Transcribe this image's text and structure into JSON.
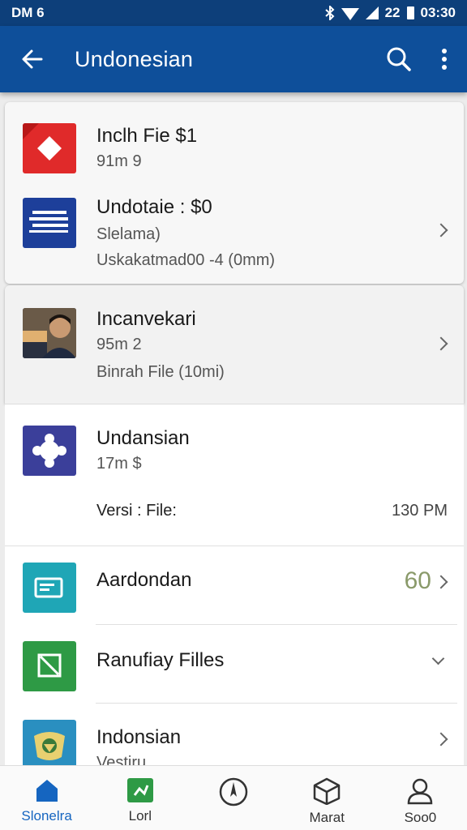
{
  "status_bar": {
    "left_text": "DM 6",
    "right_number": "22",
    "time": "03:30"
  },
  "app_bar": {
    "title": "Undonesian"
  },
  "items": [
    {
      "title": "Inclh Fie $1",
      "subtitle": "91m 9",
      "icon": "red-diamond-icon",
      "accent": "#e02a2a"
    },
    {
      "title": "Undotaie : $0",
      "subtitle": "Slelama)",
      "detail": "Uskakatmad00 -4 (0mm)",
      "icon": "flag-icon",
      "accent": "#1d3f9a"
    },
    {
      "title": "Incanvekari",
      "subtitle": "95m 2",
      "detail": "Binrah File (10mi)",
      "icon": "person-photo-icon"
    },
    {
      "title": "Undansian",
      "subtitle": "17m $",
      "detail_label": "Versi : File:",
      "detail_value": "130 PM",
      "icon": "puzzle-icon",
      "accent": "#3b3f9a"
    },
    {
      "title": "Aardondan",
      "value": "60",
      "value_color": "#8a9a6a",
      "icon": "card-icon",
      "accent": "#1fa6b6"
    },
    {
      "title": "Ranufiay Filles",
      "icon": "square-slash-icon",
      "accent": "#2e9a45"
    },
    {
      "title": "Indonsian",
      "subtitle": "Vestiru",
      "icon": "emblem-icon",
      "accent": "#2a8fc0"
    }
  ],
  "bottom_nav": [
    {
      "label": "Slonelra",
      "icon": "home-icon",
      "active": true
    },
    {
      "label": "Lorl",
      "icon": "tag-icon",
      "active": false
    },
    {
      "label": "",
      "icon": "compass-icon",
      "active": false
    },
    {
      "label": "Marat",
      "icon": "box-icon",
      "active": false
    },
    {
      "label": "Soo0",
      "icon": "person-icon",
      "active": false
    }
  ],
  "colors": {
    "app_bar": "#0e4f9a",
    "status_bar": "#0d3f7a",
    "active_nav": "#1565c0"
  }
}
